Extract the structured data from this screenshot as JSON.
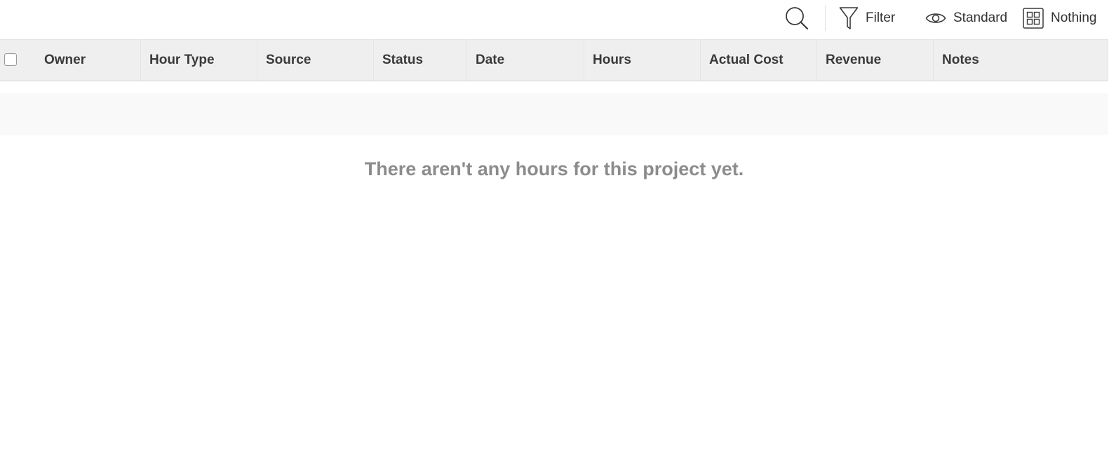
{
  "toolbar": {
    "search_icon": "search-icon",
    "filter_label": "Filter",
    "view_label": "Standard",
    "group_label": "Nothing"
  },
  "grid": {
    "columns": [
      "Owner",
      "Hour Type",
      "Source",
      "Status",
      "Date",
      "Hours",
      "Actual Cost",
      "Revenue",
      "Notes"
    ]
  },
  "empty_state": {
    "message": "There aren't any hours for this project yet."
  },
  "colors": {
    "header_bg": "#efefef",
    "empty_text": "#8c8c8c"
  }
}
